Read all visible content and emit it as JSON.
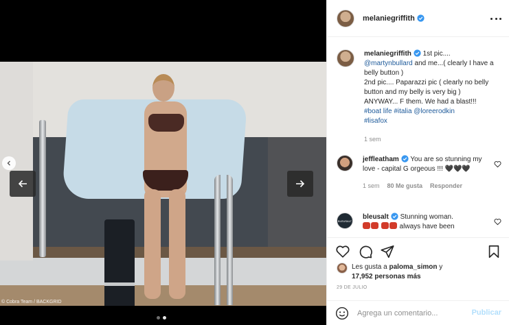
{
  "post": {
    "username": "melaniegriffith",
    "verified": true,
    "photo_credit": "© Cobra Team / BACKGRID",
    "carousel": {
      "slides": 2,
      "active_index": 1
    }
  },
  "caption": {
    "username": "melaniegriffith",
    "line1": " 1st pic....",
    "mention1": "@martynbullard",
    "line2": " and me...( clearly I have a belly button )",
    "line3": "2nd pic.... Paparazzi pic ( clearly no belly button and my belly is very big ) ANYWAY... F them. We had a blast!!!",
    "tag1": "#boat life",
    "tag2": "#italia",
    "mention2": "@loreerodkin",
    "tag3": "#lisafox",
    "time": "1 sem"
  },
  "comments": [
    {
      "username": "jeffleatham",
      "verified": true,
      "text": " You are so stunning my love - capital G orgeous !!! 🖤🖤🖤",
      "time": "1 sem",
      "likes": "80 Me gusta",
      "reply": "Responder"
    },
    {
      "username": "bleusalt",
      "verified": true,
      "text": " Stunning woman.",
      "text2": " always have been",
      "avatar_label": "BLEUSALT"
    }
  ],
  "likes": {
    "prefix": "Les gusta a ",
    "user": "paloma_simon",
    "mid": " y",
    "count": "17,952 personas más"
  },
  "date": "29 DE JULIO",
  "composer": {
    "placeholder": "Agrega un comentario...",
    "post_label": "Publicar"
  },
  "colors": {
    "verified": "#3897f0",
    "link": "#1e5a9a",
    "muted": "#8e8e8e",
    "post_disabled": "#b2dffc"
  },
  "icons": [
    "verified-icon",
    "more-icon",
    "heart-icon",
    "comment-icon",
    "share-icon",
    "bookmark-icon",
    "smile-icon",
    "arrow-left-icon",
    "arrow-right-icon"
  ]
}
